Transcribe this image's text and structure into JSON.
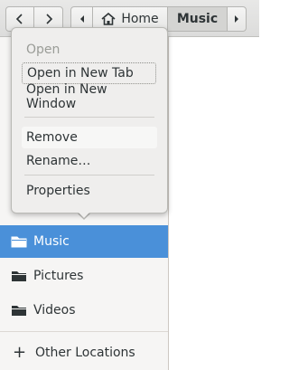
{
  "headerbar": {
    "back_icon": "chevron-left-icon",
    "forward_icon": "chevron-right-icon",
    "path": {
      "scroll_left_icon": "chevron-left-icon",
      "home_label": "Home",
      "home_icon": "home-icon",
      "current_label": "Music",
      "scroll_right_icon": "chevron-right-icon"
    }
  },
  "context_menu": {
    "items": [
      {
        "label": "Open",
        "state": "disabled"
      },
      {
        "label": "Open in New Tab",
        "state": "focused"
      },
      {
        "label": "Open in New Window",
        "state": "normal"
      },
      {
        "label": "Remove",
        "state": "hover"
      },
      {
        "label": "Rename…",
        "state": "normal"
      },
      {
        "label": "Properties",
        "state": "normal"
      }
    ]
  },
  "sidebar": {
    "places": [
      {
        "label": "Music",
        "icon": "folder-icon",
        "selected": true
      },
      {
        "label": "Pictures",
        "icon": "folder-icon",
        "selected": false
      },
      {
        "label": "Videos",
        "icon": "folder-icon",
        "selected": false
      }
    ],
    "other_locations": {
      "label": "Other Locations",
      "icon": "plus-icon"
    }
  },
  "colors": {
    "selection": "#4a90d9",
    "sidebar_bg": "#f6f5f4",
    "menu_bg": "#efeeed"
  }
}
